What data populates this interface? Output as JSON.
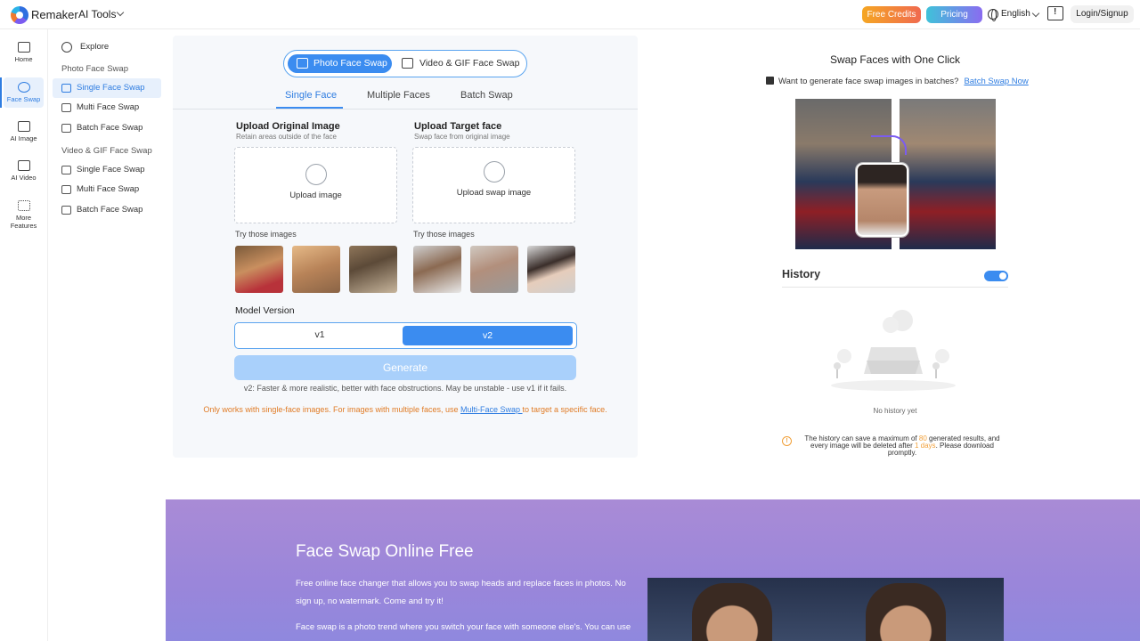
{
  "header": {
    "brand": "Remaker",
    "ai_tools": "AI Tools",
    "free_credits": "Free Credits",
    "pricing": "Pricing",
    "language": "English",
    "login": "Login/Signup"
  },
  "rail": {
    "items": [
      {
        "label": "Home",
        "icon": "home-icon"
      },
      {
        "label": "Face Swap",
        "icon": "face-swap-icon"
      },
      {
        "label": "AI Image",
        "icon": "image-icon"
      },
      {
        "label": "AI Video",
        "icon": "video-icon"
      },
      {
        "label": "More Features",
        "icon": "grid-icon"
      }
    ]
  },
  "subnav": {
    "explore": "Explore",
    "photo_section": "Photo Face Swap",
    "photo_items": [
      "Single Face Swap",
      "Multi Face Swap",
      "Batch Face Swap"
    ],
    "video_section": "Video & GIF Face Swap",
    "video_items": [
      "Single Face Swap",
      "Multi Face Swap",
      "Batch Face Swap"
    ]
  },
  "tool": {
    "mode_photo": "Photo Face Swap",
    "mode_video": "Video & GIF Face Swap",
    "tabs": [
      "Single Face",
      "Multiple Faces",
      "Batch Swap"
    ],
    "original": {
      "title": "Upload Original Image",
      "subtitle": "Retain areas outside of the face",
      "button": "Upload image",
      "try": "Try those images"
    },
    "target": {
      "title": "Upload Target face",
      "subtitle": "Swap face from original image",
      "button": "Upload swap image",
      "try": "Try those images"
    },
    "model_label": "Model Version",
    "model_v1": "v1",
    "model_v2": "v2",
    "generate": "Generate",
    "note_v2": "v2: Faster & more realistic, better with face obstructions. May be unstable - use v1 if it fails.",
    "note_single_pre": "Only works with single-face images. For images with multiple faces, use ",
    "note_single_link": "Multi-Face Swap ",
    "note_single_post": "to target a specific face."
  },
  "right": {
    "title": "Swap Faces with One Click",
    "batch_q": "Want to generate face swap images in batches?",
    "batch_link": "Batch Swap Now",
    "history": "History",
    "history_toggle_on": true,
    "no_history": "No history yet",
    "warn_1": "The history can save a maximum of ",
    "warn_max": "80",
    "warn_2": " generated results, and every image will be deleted after ",
    "warn_days": "1 days",
    "warn_3": ". Please download promptly."
  },
  "promo": {
    "title": "Face Swap Online Free",
    "p1": "Free online face changer that allows you to swap heads and replace faces in photos. No sign up, no watermark. Come and try it!",
    "p2": "Face swap is a photo trend where you switch your face with someone else's. You can use"
  },
  "colors": {
    "accent": "#3b8cf0",
    "warning": "#e07b25",
    "promo_bg": "#a98bd6"
  }
}
